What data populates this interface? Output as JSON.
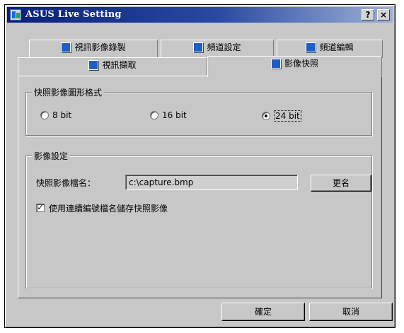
{
  "window": {
    "title": "ASUS Live Setting",
    "help_button": "?",
    "close_button": "×"
  },
  "tabs": {
    "back_row": [
      {
        "label": "視訊影像錄製"
      },
      {
        "label": "頻道設定"
      },
      {
        "label": "頻道編輯"
      }
    ],
    "front_row": [
      {
        "label": "視訊擷取"
      },
      {
        "label": "影像快照",
        "active": true
      }
    ]
  },
  "format_group": {
    "title": "快照影像圖形格式",
    "options": [
      {
        "label": "8 bit",
        "selected": false
      },
      {
        "label": "16 bit",
        "selected": false
      },
      {
        "label": "24 bit",
        "selected": true
      }
    ]
  },
  "image_group": {
    "title": "影像設定",
    "filename_label": "快照影像檔名：",
    "filename_value": "c:\\capture.bmp",
    "rename_button": "更名",
    "auto_name_checkbox": {
      "label": "使用連續編號檔名儲存快照影像",
      "checked": true,
      "mark": "✓"
    }
  },
  "footer": {
    "ok_button": "確定",
    "cancel_button": "取消"
  }
}
